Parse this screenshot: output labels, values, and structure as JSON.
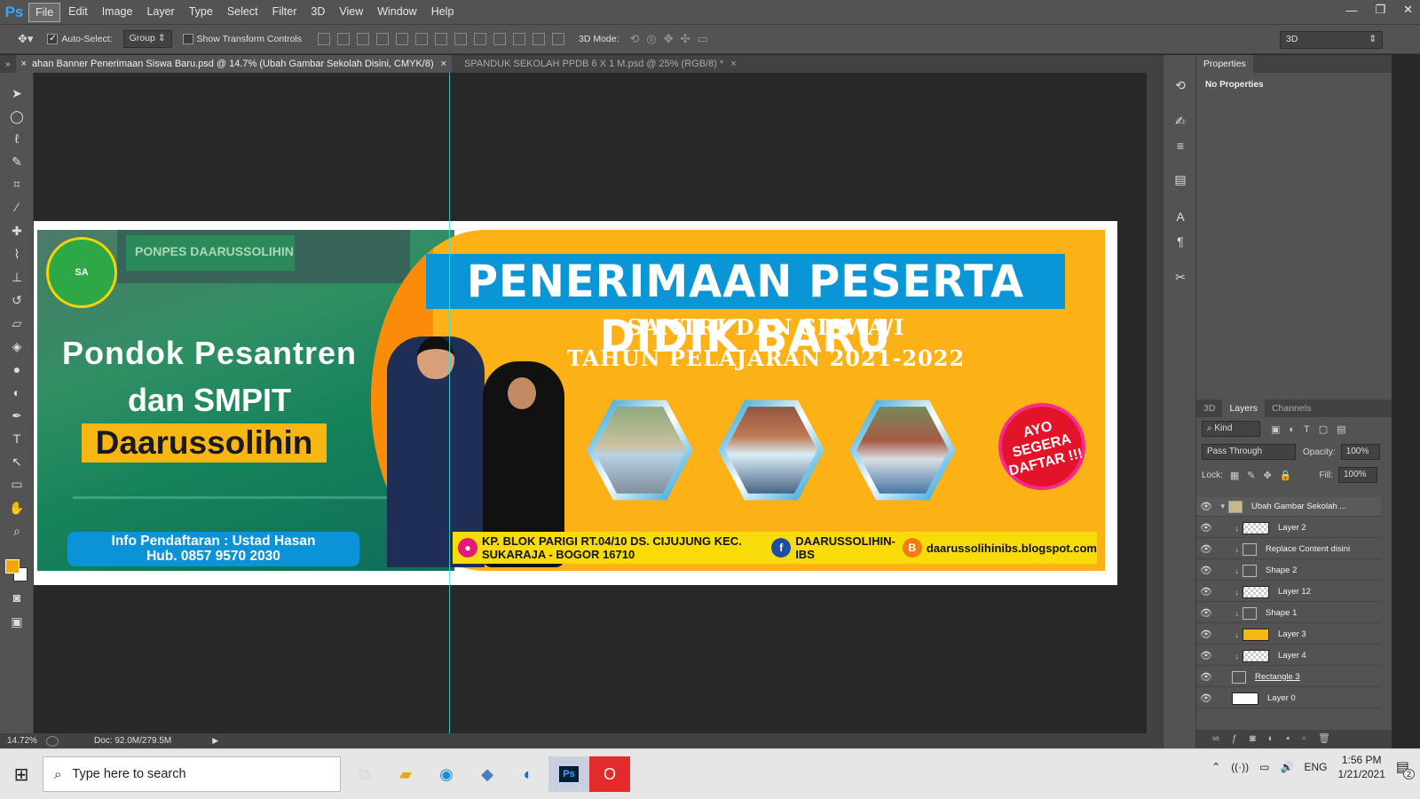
{
  "app": {
    "logo_text": "Ps"
  },
  "menu": [
    "File",
    "Edit",
    "Image",
    "Layer",
    "Type",
    "Select",
    "Filter",
    "3D",
    "View",
    "Window",
    "Help"
  ],
  "window_controls": [
    "—",
    "❐",
    "✕"
  ],
  "options_bar": {
    "auto_select_label": "Auto-Select:",
    "auto_select_value": "Group",
    "show_transform_label": "Show Transform Controls",
    "mode_label": "3D Mode:",
    "workspace_value": "3D"
  },
  "tabs": [
    {
      "label": "ahan Banner Penerimaan Siswa Baru.psd @ 14.7% (Ubah Gambar Sekolah Disini, CMYK/8)",
      "close": "×"
    },
    {
      "label": "SPANDUK SEKOLAH PPDB 6 X 1 M.psd @ 25% (RGB/8) *",
      "close": "×"
    }
  ],
  "banner": {
    "sign_text": "PONPES DAARUSSOLIHIN",
    "logo_text": "SA",
    "pondok": "Pondok Pesantren",
    "smpit": "dan SMPIT",
    "name": "Daarussolihin",
    "info_line1": "Info Pendaftaran : Ustad Hasan",
    "info_line2": "Hub. 0857 9570 2030",
    "headline": "PENERIMAAN PESERTA DIDIK BARU",
    "sub1": "SANTRI DAN SISWA/I",
    "sub2": "TAHUN PELAJARAN 2021-2022",
    "daftar": "AYO SEGERA DAFTAR !!!",
    "address": "KP. BLOK PARIGI RT.04/10 DS. CIJUJUNG KEC. SUKARAJA - BOGOR 16710",
    "facebook": "DAARUSSOLIHIN-IBS",
    "blog": "daarussolihinibs.blogspot.com",
    "colors": {
      "orange": "#fcb117",
      "blue": "#0a96d6",
      "green": "#16835a",
      "yellow": "#f8dc0a"
    }
  },
  "status": {
    "zoom": "14.72%",
    "doc": "Doc: 92.0M/279.5M"
  },
  "properties": {
    "title": "Properties",
    "body": "No Properties"
  },
  "layers_panel": {
    "tabs": [
      "3D",
      "Layers",
      "Channels"
    ],
    "filter": "Kind",
    "blend_mode": "Pass Through",
    "opacity_label": "Opacity:",
    "opacity_value": "100%",
    "lock_label": "Lock:",
    "fill_label": "Fill:",
    "fill_value": "100%",
    "layers": [
      {
        "name": "Ubah Gambar Sekolah ...",
        "kind": "group"
      },
      {
        "name": "Layer 2",
        "kind": "pixel"
      },
      {
        "name": "Replace Content disini",
        "kind": "smart"
      },
      {
        "name": "Shape 2",
        "kind": "shape"
      },
      {
        "name": "Layer 12",
        "kind": "pixel"
      },
      {
        "name": "Shape 1",
        "kind": "shape"
      },
      {
        "name": "Layer 3",
        "kind": "fill"
      },
      {
        "name": "Layer 4",
        "kind": "pixel"
      },
      {
        "name": "Rectangle 3",
        "kind": "shape"
      },
      {
        "name": "Layer 0",
        "kind": "white"
      }
    ]
  },
  "taskbar": {
    "search_placeholder": "Type here to search",
    "lang": "ENG",
    "time": "1:56 PM",
    "date": "1/21/2021",
    "notif_count": "2"
  }
}
